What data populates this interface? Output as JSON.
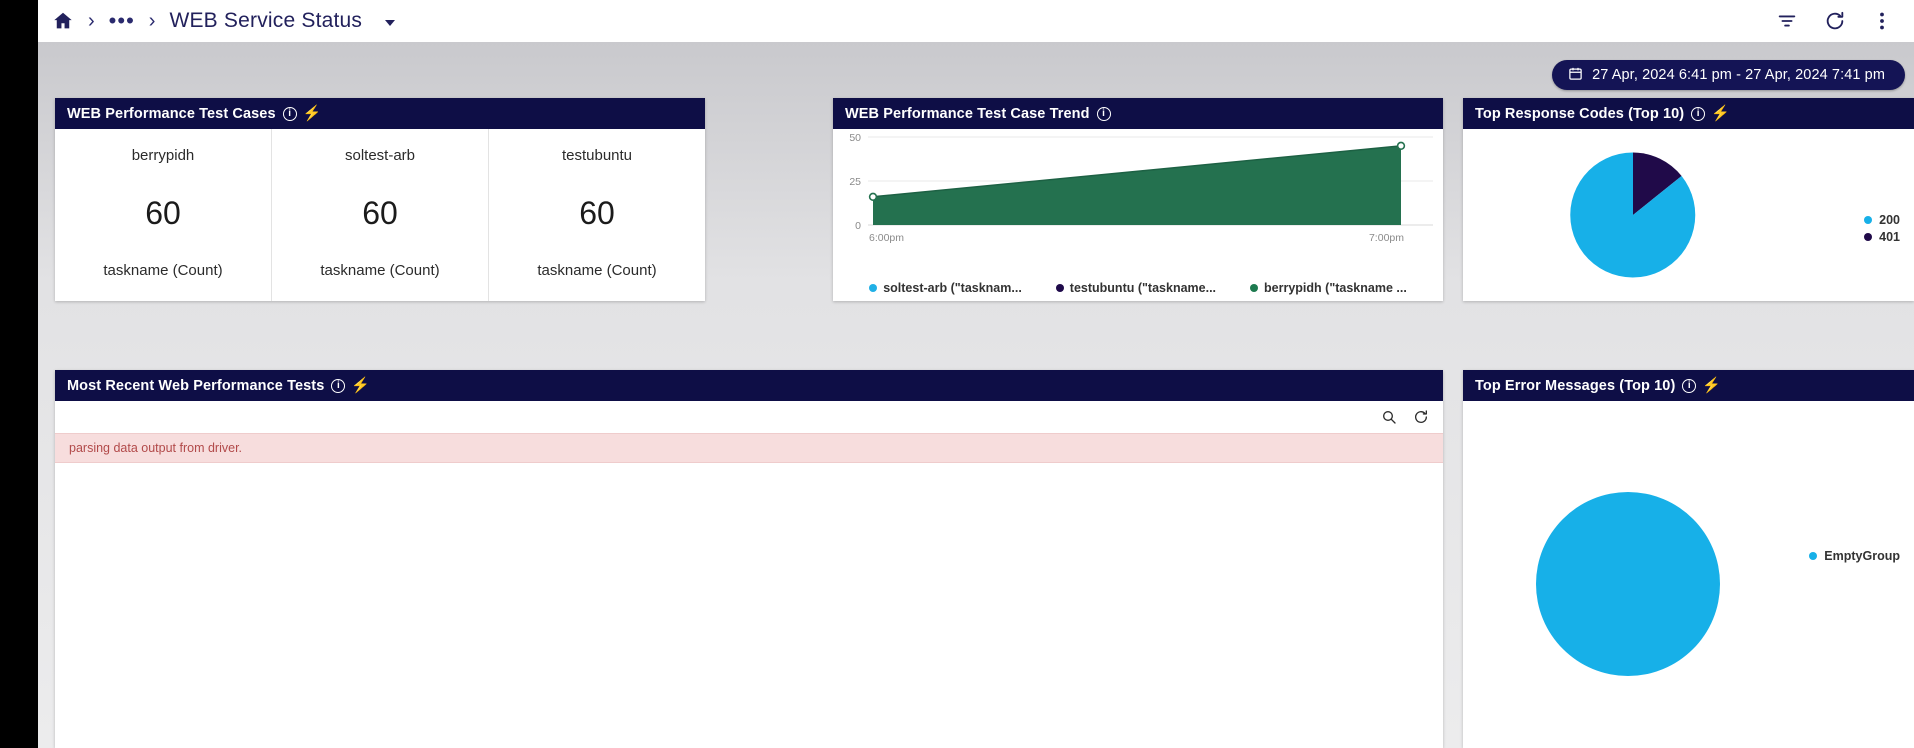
{
  "header": {
    "home_icon": "home-icon",
    "separator": "›",
    "ellipsis": "•••",
    "title": "WEB Service Status",
    "caret_icon": "chevron-down-icon",
    "filter_icon": "filter-icon",
    "refresh_icon": "refresh-icon",
    "more_icon": "more-vertical-icon"
  },
  "toolbar": {
    "date_range": "27 Apr, 2024 6:41 pm - 27 Apr, 2024 7:41 pm",
    "calendar_icon": "calendar-icon"
  },
  "panels": {
    "test_cases": {
      "title": "WEB Performance Test Cases",
      "info_icon": "info-icon",
      "bolt_icon": "lightning-bolt-icon",
      "cells": [
        {
          "name": "berrypidh",
          "value": "60",
          "label": "taskname (Count)"
        },
        {
          "name": "soltest-arb",
          "value": "60",
          "label": "taskname (Count)"
        },
        {
          "name": "testubuntu",
          "value": "60",
          "label": "taskname (Count)"
        }
      ]
    },
    "trend": {
      "title": "WEB Performance Test Case Trend",
      "info_icon": "info-icon",
      "legend": [
        {
          "label": "soltest-arb (\"tasknam...",
          "color": "#21b0e6"
        },
        {
          "label": "testubuntu (\"taskname...",
          "color": "#1f0a4a"
        },
        {
          "label": "berrypidh (\"taskname ...",
          "color": "#1d7a4f"
        }
      ]
    },
    "response_codes": {
      "title": "Top Response Codes (Top 10)",
      "info_icon": "info-icon",
      "bolt_icon": "lightning-bolt-icon",
      "legend": [
        {
          "label": "200",
          "color": "#17b0e8"
        },
        {
          "label": "401",
          "color": "#200a49"
        }
      ]
    },
    "recent_tests": {
      "title": "Most Recent Web Performance Tests",
      "info_icon": "info-icon",
      "bolt_icon": "lightning-bolt-icon",
      "search_icon": "search-icon",
      "refresh_icon": "refresh-icon",
      "error_message": "parsing data output from driver."
    },
    "error_messages": {
      "title": "Top Error Messages (Top 10)",
      "info_icon": "info-icon",
      "bolt_icon": "lightning-bolt-icon",
      "legend": [
        {
          "label": "EmptyGroup",
          "color": "#17b0e8"
        }
      ]
    }
  },
  "chart_data": [
    {
      "type": "area",
      "title": "WEB Performance Test Case Trend",
      "xlabel": "",
      "ylabel": "",
      "x": [
        "6:00pm",
        "7:00pm"
      ],
      "xticks": [
        "6:00pm",
        "7:00pm"
      ],
      "yticks": [
        0,
        25,
        50
      ],
      "ylim": [
        0,
        50
      ],
      "grid": true,
      "legend_position": "bottom",
      "series": [
        {
          "name": "berrypidh (\"taskname ...",
          "color": "#1d7a4f",
          "values": [
            16,
            45
          ]
        },
        {
          "name": "soltest-arb (\"tasknam...",
          "color": "#21b0e6",
          "values": [
            16,
            45
          ]
        },
        {
          "name": "testubuntu (\"taskname...",
          "color": "#1f0a4a",
          "values": [
            16,
            45
          ]
        }
      ]
    },
    {
      "type": "pie",
      "title": "Top Response Codes (Top 10)",
      "labels": [
        "200",
        "401"
      ],
      "values": [
        82,
        18
      ],
      "colors": [
        "#17b0e8",
        "#200a49"
      ],
      "legend_position": "right"
    },
    {
      "type": "pie",
      "title": "Top Error Messages (Top 10)",
      "labels": [
        "EmptyGroup"
      ],
      "values": [
        100
      ],
      "colors": [
        "#17b0e8"
      ],
      "legend_position": "right"
    }
  ]
}
